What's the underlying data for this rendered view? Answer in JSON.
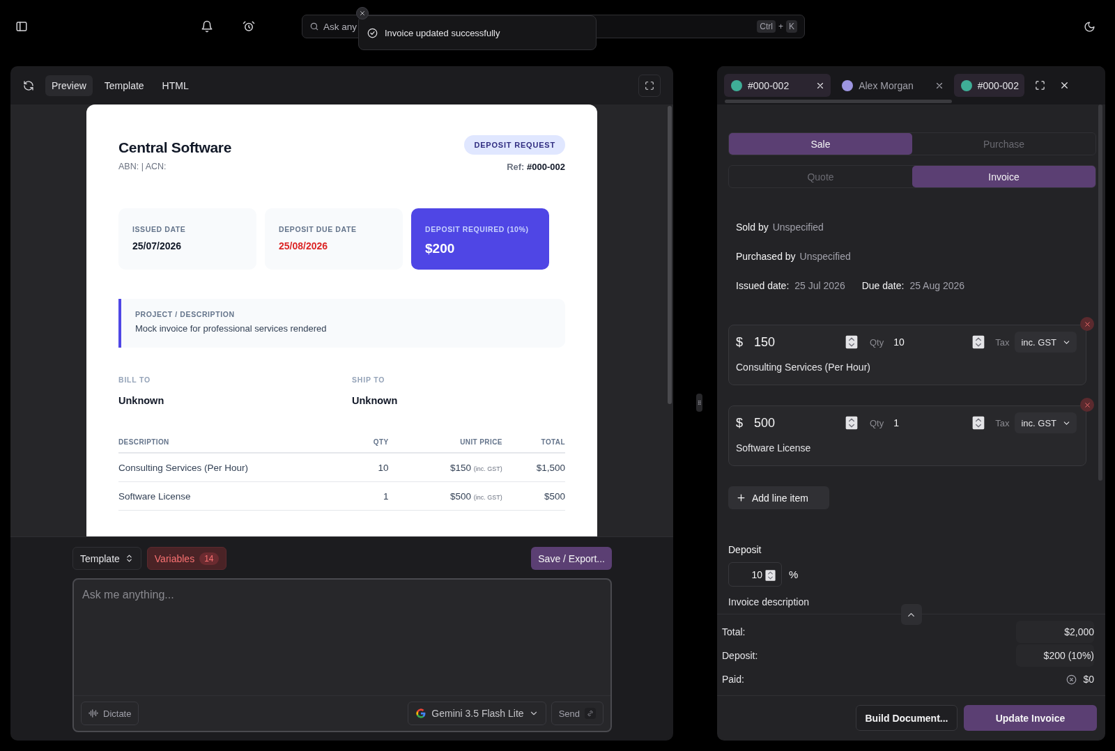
{
  "topbar": {
    "search_placeholder": "Ask any",
    "shortcut": [
      "Ctrl",
      "+",
      "K"
    ]
  },
  "toast": {
    "message": "Invoice updated successfully"
  },
  "preview": {
    "tabs": [
      {
        "label": "Preview",
        "selected": true
      },
      {
        "label": "Template",
        "selected": false
      },
      {
        "label": "HTML",
        "selected": false
      }
    ]
  },
  "document": {
    "company": "Central Software",
    "ids": "ABN: | ACN:",
    "badge": "DEPOSIT REQUEST",
    "ref_label": "Ref:",
    "ref": "#000-002",
    "cards": [
      {
        "label": "ISSUED DATE",
        "value": "25/07/2026",
        "kind": "plain"
      },
      {
        "label": "DEPOSIT DUE DATE",
        "value": "25/08/2026",
        "kind": "due"
      },
      {
        "label": "DEPOSIT REQUIRED (10%)",
        "value": "$200",
        "kind": "highlight"
      }
    ],
    "description": {
      "label": "PROJECT / DESCRIPTION",
      "text": "Mock invoice for professional services rendered"
    },
    "bill_to": {
      "label": "BILL TO",
      "value": "Unknown"
    },
    "ship_to": {
      "label": "SHIP TO",
      "value": "Unknown"
    },
    "table": {
      "columns": [
        "DESCRIPTION",
        "QTY",
        "UNIT PRICE",
        "TOTAL"
      ],
      "rows": [
        {
          "description": "Consulting Services (Per Hour)",
          "qty": "10",
          "unit_price": "$150",
          "tax_note": "(inc. GST)",
          "total": "$1,500"
        },
        {
          "description": "Software License",
          "qty": "1",
          "unit_price": "$500",
          "tax_note": "(inc. GST)",
          "total": "$500"
        }
      ]
    }
  },
  "composer": {
    "template_select": "Template",
    "variables": {
      "label": "Variables",
      "count": "14"
    },
    "save": "Save / Export...",
    "placeholder": "Ask me anything...",
    "dictate": "Dictate",
    "model": "Gemini 3.5 Flash Lite",
    "send": "Send"
  },
  "editor": {
    "tabs": [
      {
        "label": "#000-002",
        "selected": true,
        "color": "#3fae97"
      },
      {
        "label": "Alex Morgan",
        "selected": false,
        "color": "#9d95e0"
      },
      {
        "label": "#000-002",
        "selected": true,
        "color": "#3fae97"
      }
    ],
    "segments": [
      {
        "options": [
          {
            "label": "Sale",
            "selected": true
          },
          {
            "label": "Purchase",
            "selected": false
          }
        ]
      },
      {
        "options": [
          {
            "label": "Quote",
            "selected": false
          },
          {
            "label": "Invoice",
            "selected": true
          }
        ]
      }
    ],
    "parties": [
      {
        "label": "Sold by",
        "value": "Unspecified"
      },
      {
        "label": "Purchased by",
        "value": "Unspecified"
      }
    ],
    "dates": [
      {
        "label": "Issued date:",
        "value": "25 Jul 2026"
      },
      {
        "label": "Due date:",
        "value": "25 Aug 2026"
      }
    ],
    "line_items": [
      {
        "currency": "$",
        "price": "150",
        "qty_label": "Qty",
        "qty": "10",
        "tax_label": "Tax",
        "tax": "inc. GST",
        "description": "Consulting Services (Per Hour)"
      },
      {
        "currency": "$",
        "price": "500",
        "qty_label": "Qty",
        "qty": "1",
        "tax_label": "Tax",
        "tax": "inc. GST",
        "description": "Software License"
      }
    ],
    "add_line_item": "Add line item",
    "deposit": {
      "label": "Deposit",
      "value": "10",
      "unit": "%"
    },
    "next_section": "Invoice description",
    "summary": [
      {
        "label": "Total:",
        "value": "$2,000",
        "kind": "field"
      },
      {
        "label": "Deposit:",
        "value": "$200 (10%)",
        "kind": "field"
      },
      {
        "label": "Paid:",
        "value": "$0",
        "kind": "status"
      }
    ],
    "build_button": "Build Document...",
    "update_button": "Update Invoice"
  }
}
